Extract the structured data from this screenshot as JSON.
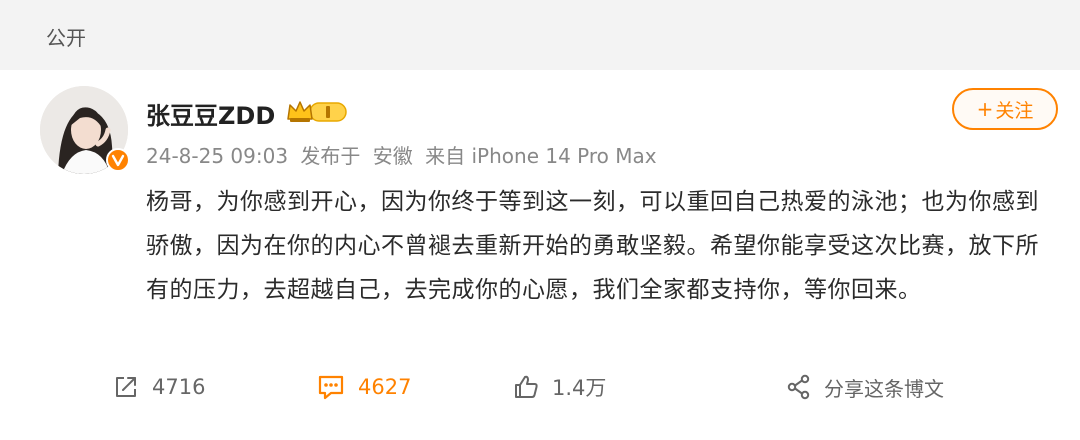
{
  "top_bar": {
    "visibility": "公开"
  },
  "user": {
    "name": "张豆豆ZDD"
  },
  "meta": {
    "date": "24-8-25 09:03",
    "posted_label": "发布于",
    "location": "安徽",
    "source": "来自 iPhone 14 Pro Max"
  },
  "follow": {
    "plus": "+",
    "label": "关注"
  },
  "post": {
    "text": "杨哥，为你感到开心，因为你终于等到这一刻，可以重回自己热爱的泳池；也为你感到骄傲，因为在你的内心不曾褪去重新开始的勇敢坚毅。希望你能享受这次比赛，放下所有的压力，去超越自己，去完成你的心愿，我们全家都支持你，等你回来。"
  },
  "actions": {
    "repost_count": "4716",
    "comment_count": "4627",
    "like_count": "1.4万",
    "share_label": "分享这条博文"
  },
  "colors": {
    "accent": "#ff8200",
    "top_bar_bg": "#f3f3f3",
    "meta_text": "#888888"
  },
  "icons": {
    "repost": "repost-icon",
    "comment": "comment-icon",
    "like": "thumbs-up-icon",
    "share": "share-icon",
    "vip": "crown-badge-icon",
    "verified": "verified-v-icon"
  }
}
